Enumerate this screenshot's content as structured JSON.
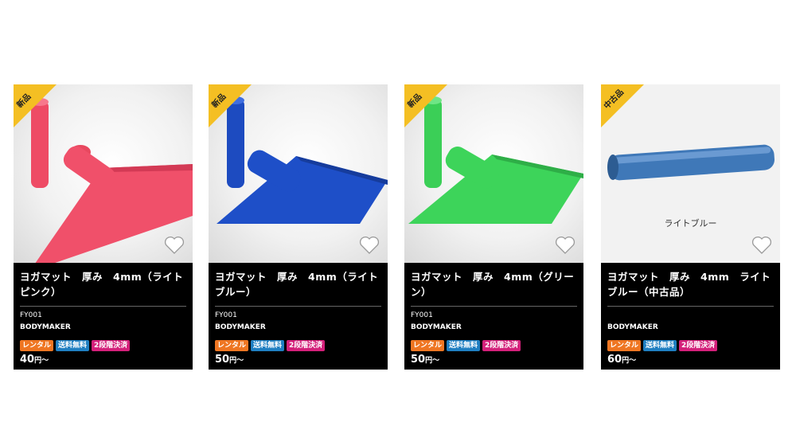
{
  "products": [
    {
      "ribbon": "新品",
      "title": "ヨガマット　厚み　4mm（ライトピンク）",
      "code": "FY001",
      "brand": "BODYMAKER",
      "tags": [
        "レンタル",
        "送料無料",
        "2段階決済"
      ],
      "price": "40",
      "price_unit": "円〜",
      "mat_color": "#f0506a",
      "mat_shade": "#d33a55"
    },
    {
      "ribbon": "新品",
      "title": "ヨガマット　厚み　4mm（ライトブルー）",
      "code": "FY001",
      "brand": "BODYMAKER",
      "tags": [
        "レンタル",
        "送料無料",
        "2段階決済"
      ],
      "price": "50",
      "price_unit": "円〜",
      "mat_color": "#1e4fc8",
      "mat_shade": "#163c9c"
    },
    {
      "ribbon": "新品",
      "title": "ヨガマット　厚み　4mm（グリーン）",
      "code": "FY001",
      "brand": "BODYMAKER",
      "tags": [
        "レンタル",
        "送料無料",
        "2段階決済"
      ],
      "price": "50",
      "price_unit": "円〜",
      "mat_color": "#3dd45a",
      "mat_shade": "#2eae47"
    },
    {
      "ribbon": "中古品",
      "title": "ヨガマット　厚み　4mm　ライトブルー（中古品）",
      "code": "",
      "brand": "BODYMAKER",
      "tags": [
        "レンタル",
        "送料無料",
        "2段階決済"
      ],
      "price": "60",
      "price_unit": "円〜",
      "image_caption": "ライトブルー",
      "mat_color": "#3f78b8",
      "mat_shade": "#2d5c92"
    }
  ],
  "icons": {
    "favorite": "heart-outline-icon"
  },
  "colors": {
    "ribbon": "#f4bf23",
    "rental": "#ef7622",
    "shipping": "#1f7fc2",
    "payment": "#d4207a"
  }
}
